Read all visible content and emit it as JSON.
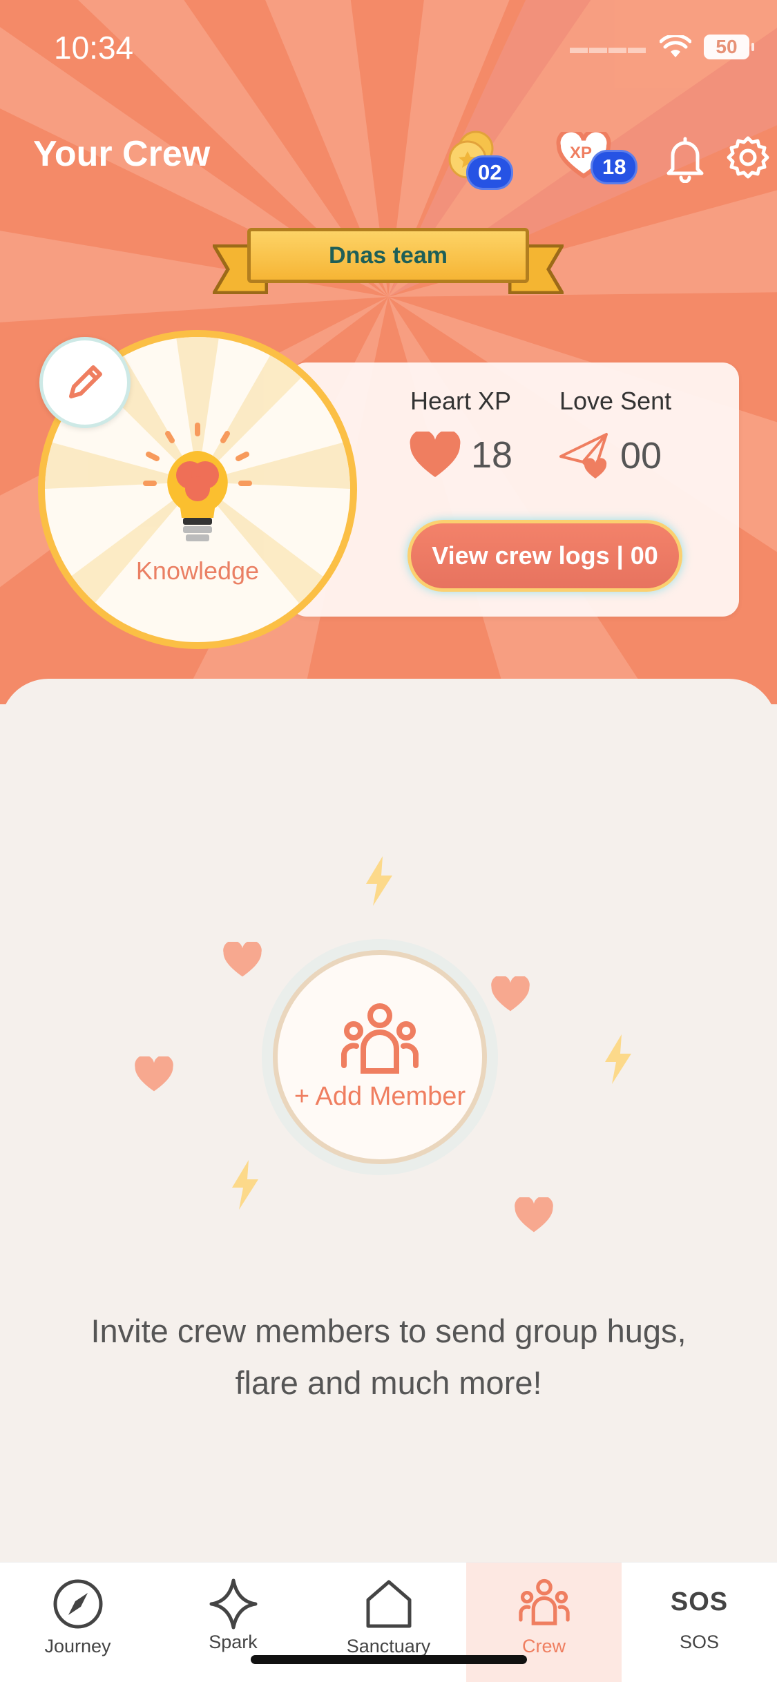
{
  "status_bar": {
    "time": "10:34",
    "battery": "50"
  },
  "header": {
    "title": "Your Crew",
    "coins": "02",
    "xp_badge_label": "XP",
    "xp": "18"
  },
  "team": {
    "name": "Dnas team"
  },
  "crew_card": {
    "topic": "Knowledge",
    "heart_xp_label": "Heart XP",
    "heart_xp_value": "18",
    "love_sent_label": "Love Sent",
    "love_sent_value": "00",
    "logs_button_label": "View crew logs | 00"
  },
  "main": {
    "add_member_label": "+ Add Member",
    "invite_text": "Invite crew members to send group hugs, flare and much more!"
  },
  "tabbar": {
    "items": [
      {
        "label": "Journey",
        "icon": "compass-icon"
      },
      {
        "label": "Spark",
        "icon": "sparkle-icon"
      },
      {
        "label": "Sanctuary",
        "icon": "home-icon"
      },
      {
        "label": "Crew",
        "icon": "crew-icon",
        "active": true
      },
      {
        "label": "SOS",
        "icon": "sos-icon",
        "icon_text": "SOS"
      }
    ]
  },
  "colors": {
    "accent": "#ef7e60",
    "hero_bg": "#f48a68",
    "badge_blue": "#2653e4",
    "gold": "#fbbf45"
  }
}
